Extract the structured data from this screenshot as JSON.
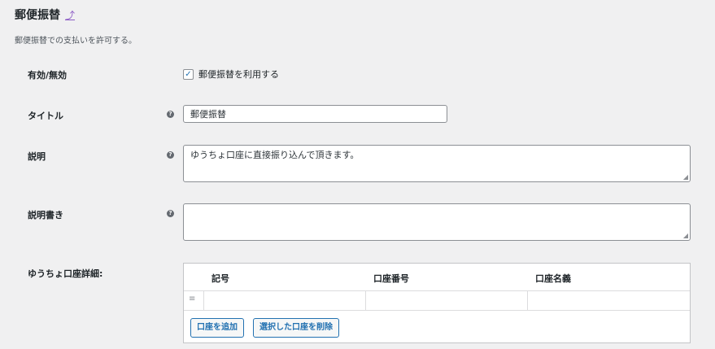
{
  "section": {
    "title": "郵便振替",
    "description": "郵便振替での支払いを許可する。"
  },
  "fields": {
    "enable": {
      "label": "有効/無効",
      "checkbox_label": "郵便振替を利用する",
      "checked": true,
      "check_glyph": "✓"
    },
    "title": {
      "label": "タイトル",
      "value": "郵便振替"
    },
    "description": {
      "label": "説明",
      "value": "ゆうちょ口座に直接振り込んで頂きます。"
    },
    "instructions": {
      "label": "説明書き",
      "value": ""
    },
    "accounts": {
      "label": "ゆうちょ口座詳細:",
      "columns": [
        "記号",
        "口座番号",
        "口座名義"
      ],
      "rows": [
        [
          "",
          "",
          ""
        ]
      ],
      "add_button": "口座を追加",
      "remove_button": "選択した口座を削除"
    }
  },
  "icons": {
    "help": "?",
    "back_arrow": "⤴",
    "drag_handle": "≡",
    "resize_grip": "◢"
  },
  "colors": {
    "accent": "#2271b1",
    "background": "#f0f0f1"
  }
}
